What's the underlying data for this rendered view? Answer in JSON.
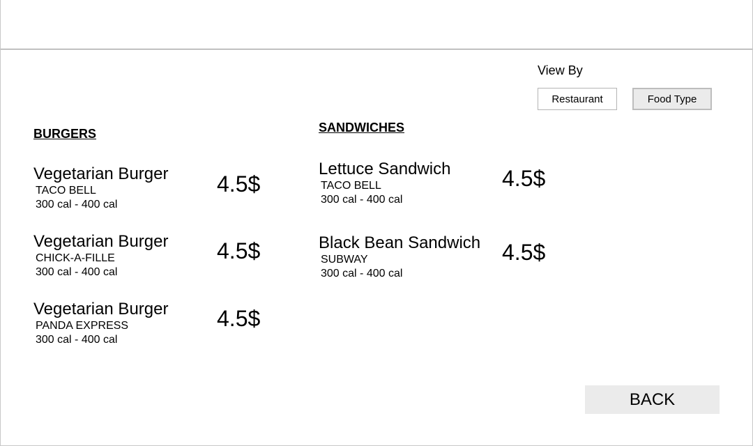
{
  "view_by": {
    "label": "View By",
    "options": [
      "Restaurant",
      "Food Type"
    ],
    "selected": "Food Type"
  },
  "sections": [
    {
      "title": "BURGERS",
      "items": [
        {
          "name": "Vegetarian Burger",
          "restaurant": "TACO BELL",
          "calories": "300 cal - 400 cal",
          "price": "4.5$"
        },
        {
          "name": "Vegetarian Burger",
          "restaurant": "CHICK-A-FILLE",
          "calories": "300 cal - 400 cal",
          "price": "4.5$"
        },
        {
          "name": "Vegetarian Burger",
          "restaurant": "PANDA EXPRESS",
          "calories": "300 cal - 400 cal",
          "price": "4.5$"
        }
      ]
    },
    {
      "title": "SANDWICHES",
      "items": [
        {
          "name": "Lettuce Sandwich",
          "restaurant": "TACO BELL",
          "calories": "300 cal - 400 cal",
          "price": "4.5$"
        },
        {
          "name": "Black Bean Sandwich",
          "restaurant": "SUBWAY",
          "calories": "300 cal - 400 cal",
          "price": "4.5$"
        }
      ]
    }
  ],
  "back_label": "BACK"
}
